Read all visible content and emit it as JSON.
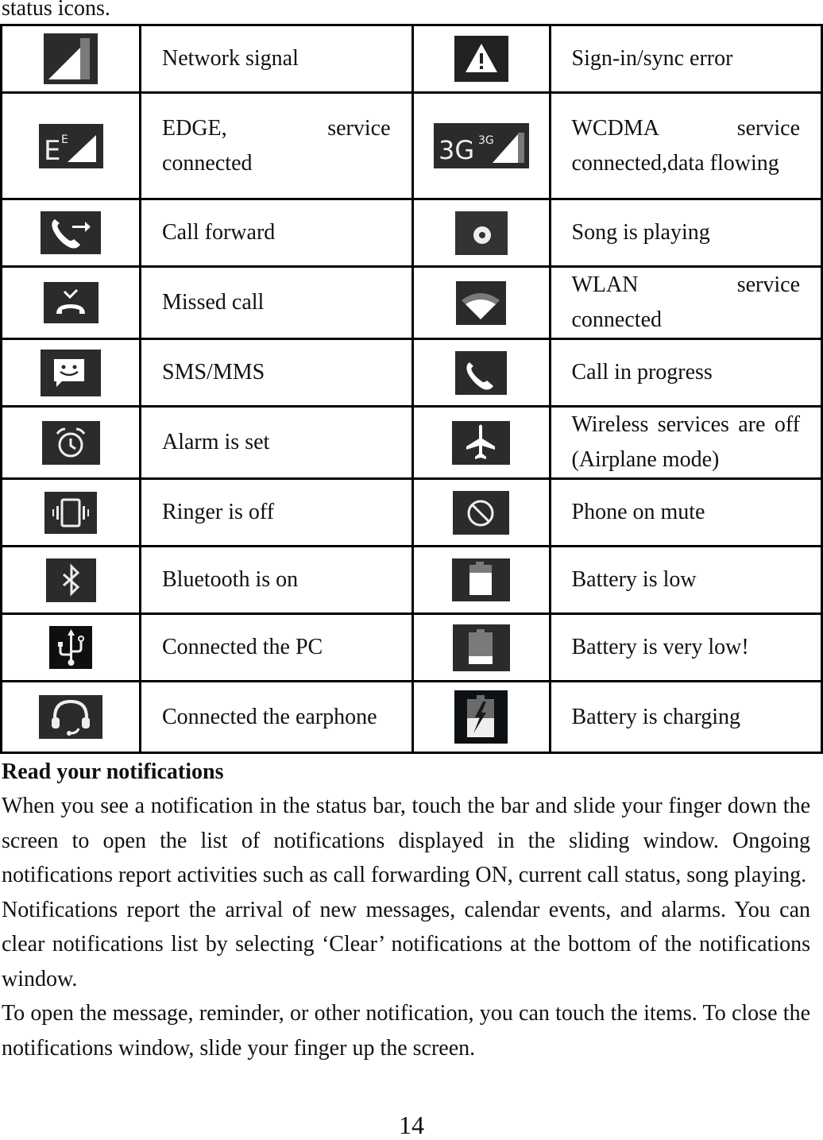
{
  "intro_text": "status icons.",
  "table": {
    "rows": [
      {
        "left": {
          "icon": "network-signal-icon",
          "label": "Network signal"
        },
        "right": {
          "icon": "warning-icon",
          "label": "Sign-in/sync error"
        }
      },
      {
        "left": {
          "icon": "edge-icon",
          "label": "EDGE, service connected",
          "icon_text": "E",
          "icon_sup": "E"
        },
        "right": {
          "icon": "3g-icon",
          "label": "WCDMA service connected,data flowing",
          "icon_text": "3G",
          "icon_sup": "3G"
        }
      },
      {
        "left": {
          "icon": "call-forward-icon",
          "label": "Call forward"
        },
        "right": {
          "icon": "song-playing-icon",
          "label": "Song is playing"
        }
      },
      {
        "left": {
          "icon": "missed-call-icon",
          "label": "Missed call"
        },
        "right": {
          "icon": "wifi-icon",
          "label": "WLAN service connected"
        }
      },
      {
        "left": {
          "icon": "sms-icon",
          "label": "SMS/MMS"
        },
        "right": {
          "icon": "call-in-progress-icon",
          "label": "Call in progress"
        }
      },
      {
        "left": {
          "icon": "alarm-icon",
          "label": "Alarm is set"
        },
        "right": {
          "icon": "airplane-icon",
          "label": "Wireless services are off (Airplane mode)"
        }
      },
      {
        "left": {
          "icon": "vibrate-icon",
          "label": "Ringer is off"
        },
        "right": {
          "icon": "mute-icon",
          "label": "Phone on mute"
        }
      },
      {
        "left": {
          "icon": "bluetooth-icon",
          "label": "Bluetooth is on"
        },
        "right": {
          "icon": "battery-low-icon",
          "label": "Battery is low"
        }
      },
      {
        "left": {
          "icon": "usb-icon",
          "label": "Connected the PC"
        },
        "right": {
          "icon": "battery-very-low-icon",
          "label": "Battery is very low!"
        }
      },
      {
        "left": {
          "icon": "headset-icon",
          "label": "Connected the earphone"
        },
        "right": {
          "icon": "battery-charging-icon",
          "label": "Battery is charging"
        }
      }
    ]
  },
  "section": {
    "heading": "Read your notifications",
    "paragraphs": [
      "When you see a notification in the status bar, touch the bar and slide your finger down the screen to open the list of notifications displayed in the sliding window. Ongoing notifications report activities such as call forwarding ON, current call status, song playing.",
      "Notifications report the arrival of new messages, calendar events, and alarms. You can clear notifications list by selecting ‘Clear’ notifications at the bottom of the notifications window.",
      "To open the message, reminder, or other notification, you can touch the items. To close the notifications window, slide your finger up the screen."
    ]
  },
  "page_number": "14",
  "colors": {
    "icon_bg": "#2b2b2b",
    "icon_fg": "#ffffff",
    "icon_dim": "#7a7a7a"
  }
}
